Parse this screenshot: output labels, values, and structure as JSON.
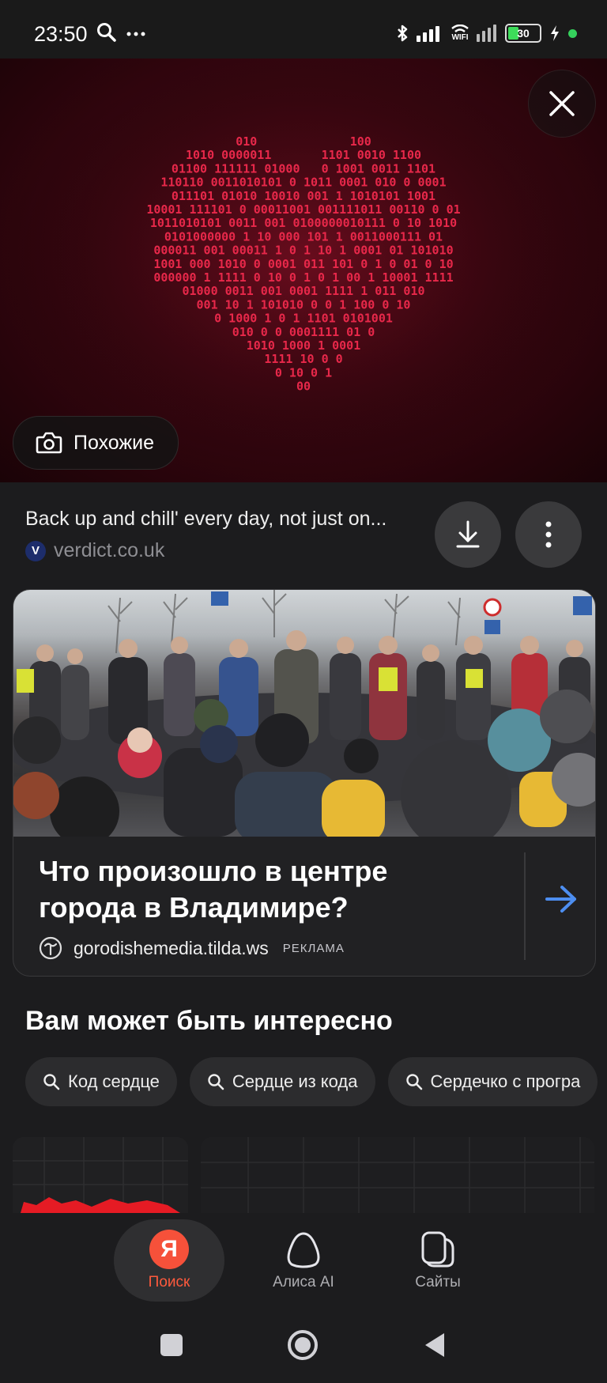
{
  "status_bar": {
    "time": "23:50",
    "battery": "30",
    "wifi_label": "WIFI"
  },
  "viewer": {
    "similar_label": "Похожие",
    "heart_rows": [
      "010             100",
      "1010 0000011       1101 0010 1100",
      "01100 111111 01000   0 1001 0011 1101",
      "110110 0011010101 0 1011 0001 010 0 0001",
      "011101 01010 10010 001 1 1010101 1001",
      "10001 111101 0 00011001 001111011 00110 0 01",
      "1011010101 0011 001 0100000010111 0 10 1010",
      "0101000000 1 10 000 101 1 0011000111 01",
      "000011 001 00011 1 0 1 10 1 0001 01 101010",
      "1001 000 1010 0 0001 011 101 0 1 0 01 0 10",
      "000000 1 1111 0 10 0 1 0 1 00 1 10001 1111",
      "01000 0011 001 0001 1111 1 011 010",
      "001 10 1 101010 0 0 1 100 0 10",
      "0 1000 1 0 1 1101 0101001",
      "010 0 0 0001111 01 0",
      "1010 1000 1 0001",
      "1111 10 0 0",
      "0 10 0 1",
      "00"
    ],
    "caption": "Back up and chill' every day, not just on...",
    "source_letter": "V",
    "source_domain": "verdict.co.uk"
  },
  "ad": {
    "headline": "Что произошло в центре города в Владимире?",
    "domain": "gorodishemedia.tilda.ws",
    "ad_label": "РЕКЛАМА"
  },
  "related": {
    "title": "Вам может быть интересно",
    "chips": [
      "Код сердце",
      "Сердце из кода",
      "Сердечко с програ"
    ]
  },
  "bottom_nav": {
    "items": [
      {
        "label": "Поиск",
        "icon_letter": "Я"
      },
      {
        "label": "Алиса AI"
      },
      {
        "label": "Сайты"
      }
    ]
  },
  "colors": {
    "accent": "#ff5a3d",
    "link_arrow": "#4d8ef0",
    "heart": "#e8284a"
  }
}
